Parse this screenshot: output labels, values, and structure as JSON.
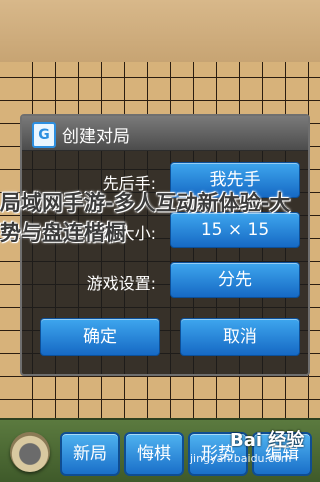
{
  "dialog": {
    "title": "创建对局",
    "rows": [
      {
        "label": "先后手:",
        "value": "我先手"
      },
      {
        "label": "棋盘大小:",
        "value": "15 × 15"
      },
      {
        "label": "游戏设置:",
        "value": "分先"
      }
    ],
    "confirm_label": "确定",
    "cancel_label": "取消"
  },
  "bottom_bar": {
    "buttons": [
      {
        "label": "新局"
      },
      {
        "label": "悔棋"
      },
      {
        "label": "形势"
      },
      {
        "label": "编辑"
      }
    ]
  },
  "overlay": {
    "line1": "局域网手游-多人互动新体验-大",
    "line2": "势与盘连楷橱"
  },
  "watermark": {
    "logo": "Bai 经验",
    "url": "jingyan.baidu.com"
  },
  "colors": {
    "button_blue": "#1e78d2",
    "dialog_bg": "#1c1c1c",
    "board_wood": "#d7b27a",
    "bottom_green": "#4f6d36"
  }
}
